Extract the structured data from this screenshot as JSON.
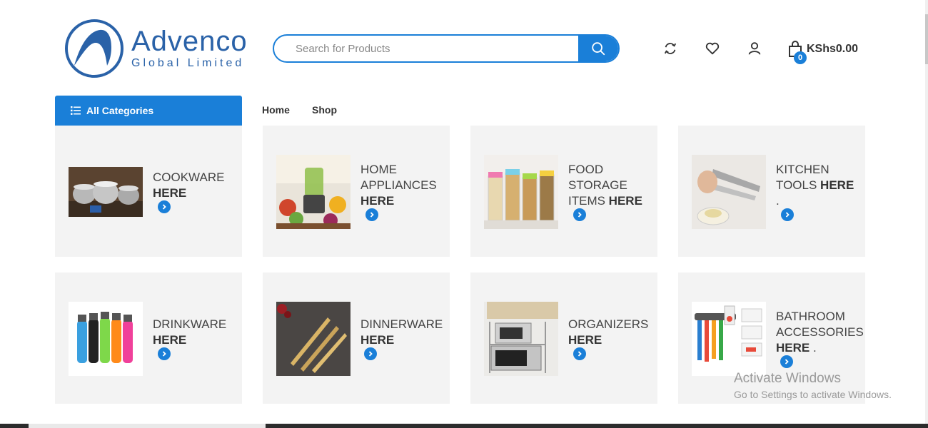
{
  "header": {
    "logo": {
      "brand": "Advenco",
      "tagline": "Global Limited",
      "icon": "advenco-logo-icon",
      "color": "#2a62a8"
    },
    "search": {
      "placeholder": "Search for Products",
      "value": "",
      "button_icon": "search-icon"
    },
    "icons": [
      "compare-icon",
      "heart-icon",
      "user-icon"
    ],
    "cart": {
      "icon": "shopping-bag-icon",
      "count": "0",
      "total": "KShs0.00"
    }
  },
  "nav": {
    "all_categories": "All Categories",
    "links": [
      "Home",
      "Shop"
    ]
  },
  "accent": "#1a7fd8",
  "categories": [
    {
      "lines": [
        "COOKWARE"
      ],
      "bold": "HERE",
      "suffix": ""
    },
    {
      "lines": [
        "HOME",
        "APPLIANCES"
      ],
      "bold": "HERE",
      "suffix": ""
    },
    {
      "lines": [
        "FOOD",
        "STORAGE",
        "ITEMS "
      ],
      "bold": "HERE",
      "suffix": ""
    },
    {
      "lines": [
        "KITCHEN",
        "TOOLS "
      ],
      "bold": "HERE",
      "suffix": "."
    },
    {
      "lines": [
        "DRINKWARE"
      ],
      "bold": "HERE",
      "suffix": ""
    },
    {
      "lines": [
        "DINNERWARE"
      ],
      "bold": "HERE",
      "suffix": ""
    },
    {
      "lines": [
        "ORGANIZERS"
      ],
      "bold": "HERE",
      "suffix": ""
    },
    {
      "lines": [
        "BATHROOM",
        "ACCESSORIES"
      ],
      "bold": "HERE",
      "suffix": " ."
    }
  ],
  "watermark": {
    "title": "Activate Windows",
    "subtitle": "Go to Settings to activate Windows."
  }
}
